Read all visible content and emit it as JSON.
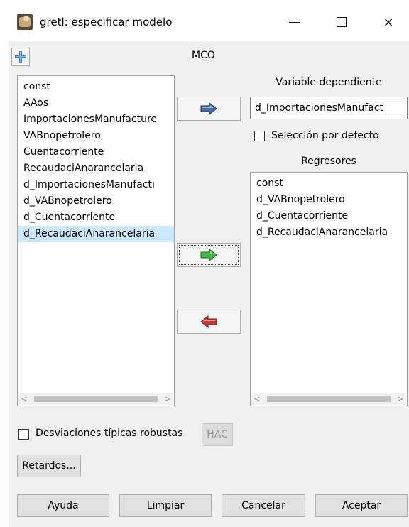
{
  "window": {
    "title": "gretl: especificar modelo",
    "icon": "gretl-app-icon"
  },
  "titlebar_buttons": {
    "minimize": "minimize-icon",
    "maximize": "maximize-icon",
    "close": "×"
  },
  "toolbar": {
    "add_icon": "plus-icon",
    "method": "MCO"
  },
  "variables_list": {
    "items": [
      "const",
      "AAos",
      "ImportacionesManufacture",
      "VABnopetrolero",
      "Cuentacorriente",
      "RecaudaciAnarancelaria",
      "d_ImportacionesManufactı",
      "d_VABnopetrolero",
      "d_Cuentacorriente",
      "d_RecaudaciAnarancelaria"
    ],
    "selected_index": 9
  },
  "dependent": {
    "label": "Variable dependiente",
    "value": "d_ImportacionesManufact"
  },
  "default_selection": {
    "label": "Selección por defecto",
    "checked": false
  },
  "regressors": {
    "label": "Regresores",
    "items": [
      "const",
      "d_VABnopetrolero",
      "d_Cuentacorriente",
      "d_RecaudaciAnarancelaria"
    ]
  },
  "arrows": {
    "set_dependent": "arrow-right-blue-icon",
    "add_regressor": "arrow-right-green-icon",
    "remove_regressor": "arrow-left-red-icon"
  },
  "options": {
    "robust_label": "Desviaciones típicas robustas",
    "robust_checked": false,
    "hac_label": "HAC",
    "lags_label": "Retardos..."
  },
  "buttons": {
    "help": "Ayuda",
    "clear": "Limpiar",
    "cancel": "Cancelar",
    "ok": "Aceptar"
  },
  "colors": {
    "selection": "#cce8ff",
    "arrow_blue": "#4a6fa5",
    "arrow_green": "#3fb83f",
    "arrow_red": "#c43a3a",
    "plus_blue": "#3a7bd5"
  }
}
